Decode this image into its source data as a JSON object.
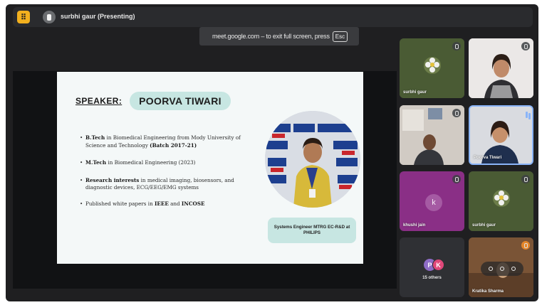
{
  "topbar": {
    "menu_icon": "grid-icon",
    "menu_glyph": "⠿",
    "present_icon": "presentation-icon",
    "presenting_label": "surbhi gaur (Presenting)"
  },
  "fullscreen_banner": {
    "text": "meet.google.com – to exit full screen, press",
    "key": "Esc"
  },
  "slide": {
    "speaker_label": "SPEAKER:",
    "speaker_name": "POORVA TIWARI",
    "bullets": [
      {
        "strong": "B.Tech",
        "text": " in Biomedical Engineering from Mody University of Science and Technology ",
        "strong2": "(Batch 2017-21)"
      },
      {
        "strong": "M.Tech",
        "text": " in Biomedical Engineering (2023)"
      },
      {
        "strong": "Research interests",
        "text": " in medical imaging, biosensors, and diagnostic devices, ECG/EEG/EMG systems"
      },
      {
        "pre": "Published white papers in ",
        "strong": "IEEE",
        "mid": " and ",
        "strong2": "INCOSE"
      }
    ],
    "caption": "Systems Engineer MTRG EC-R&D at PHILIPS"
  },
  "participants": [
    {
      "name": "surbhi gaur",
      "mic": "muted"
    },
    {
      "name": "",
      "mic": "muted"
    },
    {
      "name": "",
      "mic": "muted"
    },
    {
      "name": "Poorva Tiwari",
      "mic": "speaking"
    },
    {
      "name": "khushi jain",
      "initial": "k",
      "mic": "muted"
    },
    {
      "name": "surbhi gaur",
      "mic": "muted"
    },
    {
      "name": "",
      "initials": [
        "P",
        "K"
      ],
      "others_label": "15 others"
    },
    {
      "name": "Kratika Sharma",
      "mic": "active"
    }
  ],
  "colors": {
    "accent_yellow": "#f2b01e",
    "pill": "#c7e6e2",
    "speaking_blue": "#8ab4f8"
  }
}
